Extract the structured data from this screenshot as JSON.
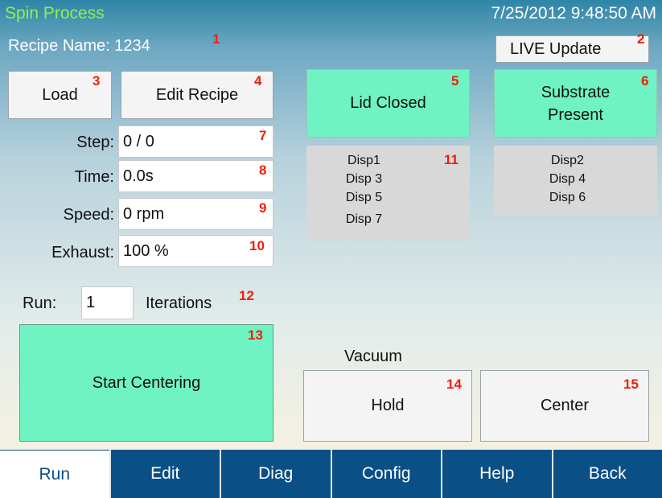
{
  "header": {
    "title": "Spin Process",
    "datetime": "7/25/2012 9:48:50 AM",
    "recipe_label": "Recipe Name: 1234"
  },
  "buttons": {
    "live_update": "LIVE Update",
    "load": "Load",
    "edit_recipe": "Edit Recipe",
    "start_centering": "Start Centering",
    "hold": "Hold",
    "center": "Center"
  },
  "status": {
    "lid": "Lid Closed",
    "substrate_line1": "Substrate",
    "substrate_line2": "Present"
  },
  "dispense": {
    "group1": [
      "Disp1",
      "Disp 3",
      "Disp 5",
      "Disp 7"
    ],
    "group2": [
      "Disp2",
      "Disp 4",
      "Disp 6"
    ]
  },
  "params": {
    "step_label": "Step:",
    "step_value": "0 / 0",
    "time_label": "Time:",
    "time_value": "0.0s",
    "speed_label": "Speed:",
    "speed_value": "0 rpm",
    "exhaust_label": "Exhaust:",
    "exhaust_value": "100 %"
  },
  "run": {
    "label": "Run:",
    "value": "1",
    "iterations_label": "Iterations"
  },
  "vacuum_label": "Vacuum",
  "markers": [
    "1",
    "2",
    "3",
    "4",
    "5",
    "6",
    "7",
    "8",
    "9",
    "10",
    "11",
    "12",
    "13",
    "14",
    "15"
  ],
  "tabs": [
    "Run",
    "Edit",
    "Diag",
    "Config",
    "Help",
    "Back"
  ],
  "colors": {
    "accent_green": "#6ff3c3",
    "title_green": "#8bf24c",
    "tab_blue": "#0b4f87",
    "marker_red": "#f01e0a"
  }
}
